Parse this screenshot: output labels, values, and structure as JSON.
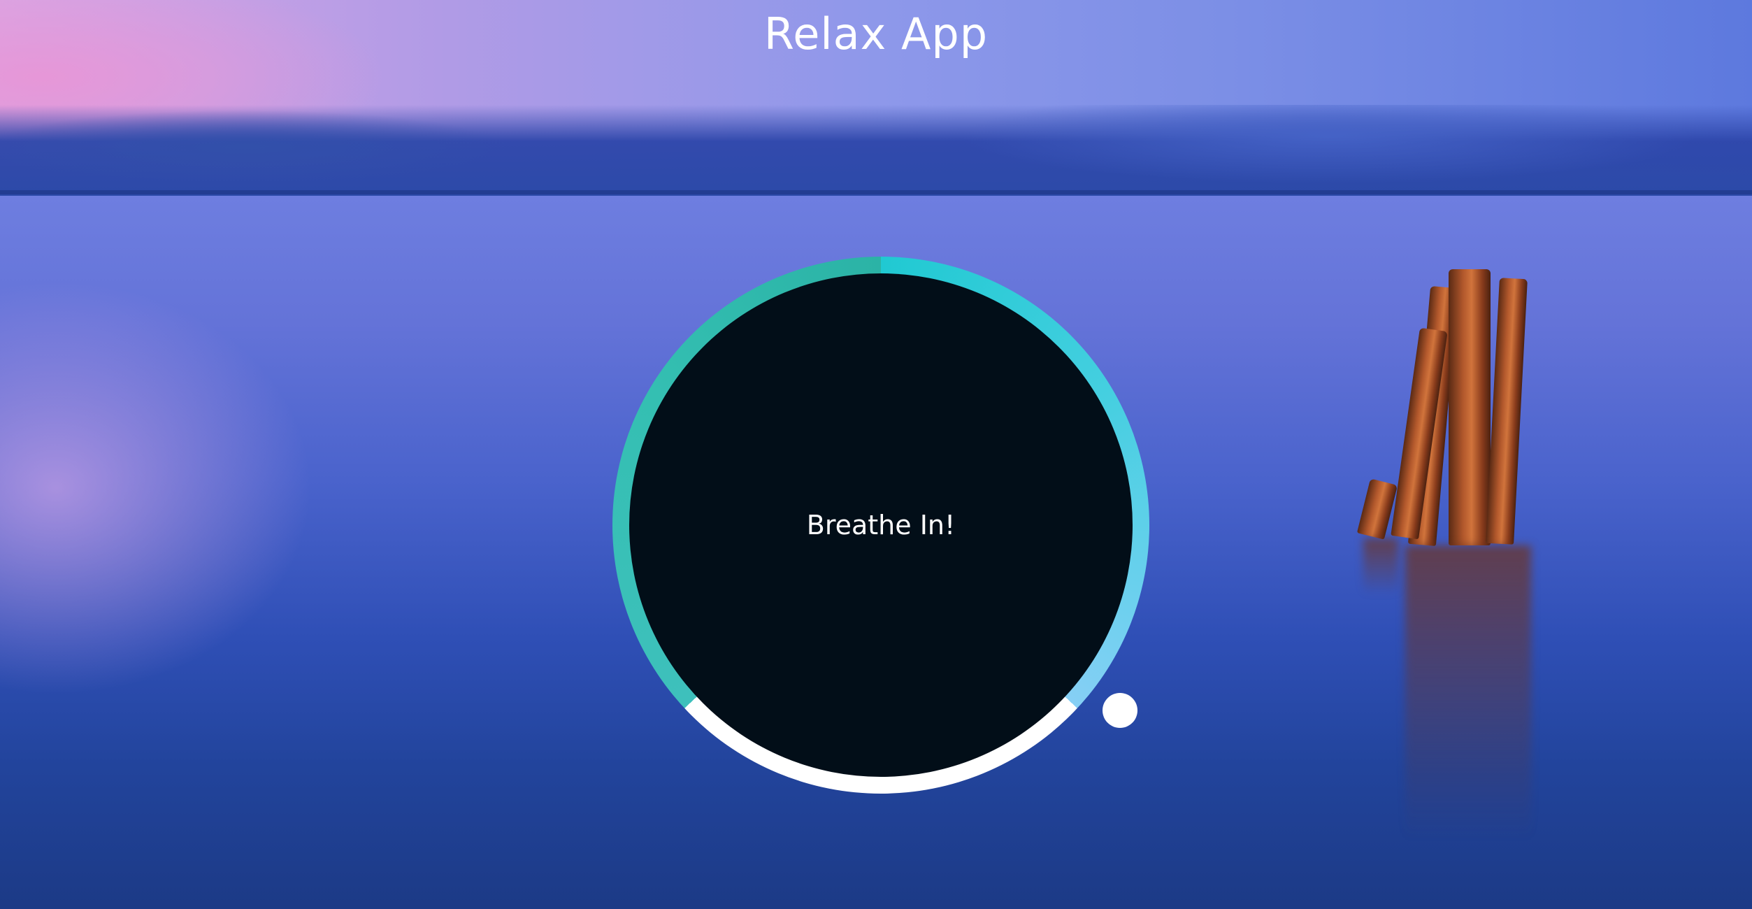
{
  "app": {
    "title": "Relax App"
  },
  "breathing": {
    "instruction": "Breathe In!",
    "ring_colors": {
      "inhale_start": "#20c9d2",
      "inhale_end": "#86cff5",
      "hold": "#ffffff",
      "exhale": "#34bfb2"
    },
    "center_color": "#020e18"
  },
  "icons": {
    "pointer": "pointer-dot"
  }
}
